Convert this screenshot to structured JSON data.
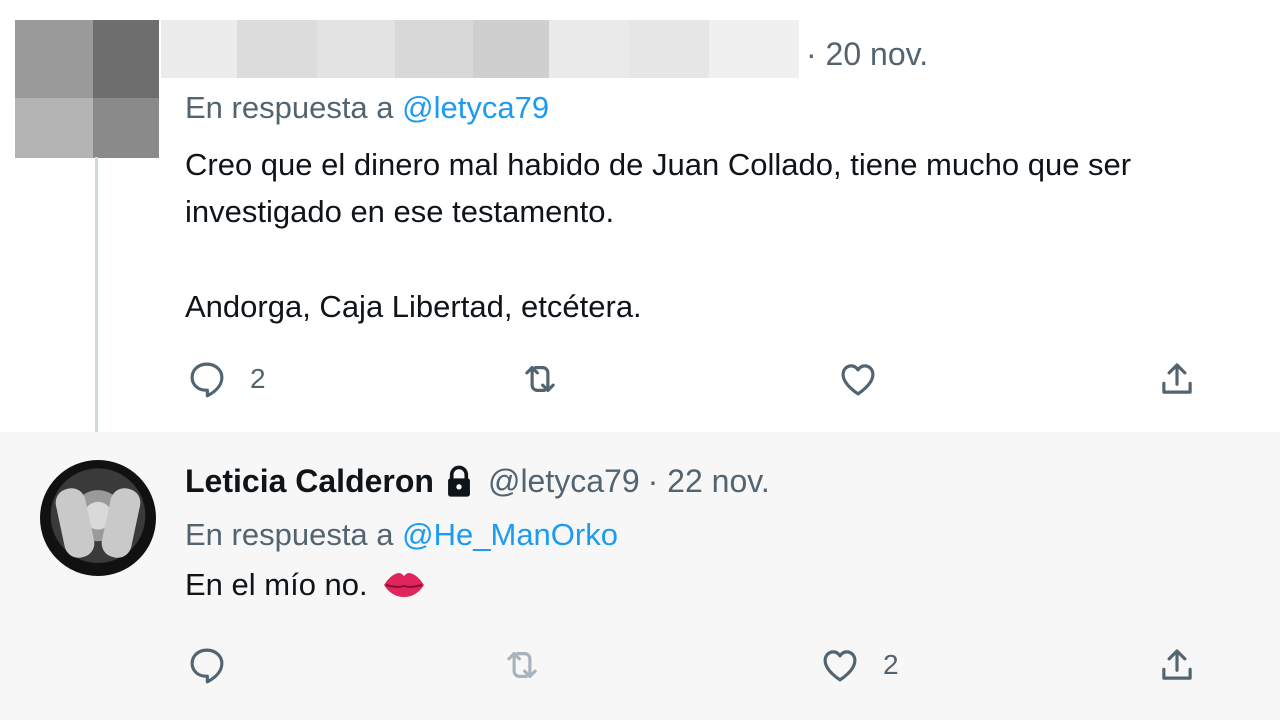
{
  "tweet1": {
    "date": "· 20 nov.",
    "reply_prefix": "En respuesta a",
    "reply_mention": "@letyca79",
    "text_line1": "Creo que el dinero mal habido de Juan Collado, tiene mucho que ser investigado en ese testamento.",
    "text_line2": "Andorga, Caja Libertad, etcétera.",
    "reply_count": "2",
    "retweet_count": "",
    "like_count": ""
  },
  "tweet2": {
    "name": "Leticia Calderon",
    "handle": "@letyca79",
    "date": "· 22 nov.",
    "reply_prefix": "En respuesta a",
    "reply_mention": "@He_ManOrko",
    "text": "En el mío no.",
    "emoji": "kiss-lips",
    "reply_count": "",
    "retweet_count": "",
    "like_count": "2"
  },
  "colors": {
    "text": "#0f1419",
    "muted": "#536471",
    "link": "#1d9bf0",
    "thread_line": "#cfd9de",
    "highlight_bg": "#f7f7f7",
    "kiss": "#e0245e"
  }
}
